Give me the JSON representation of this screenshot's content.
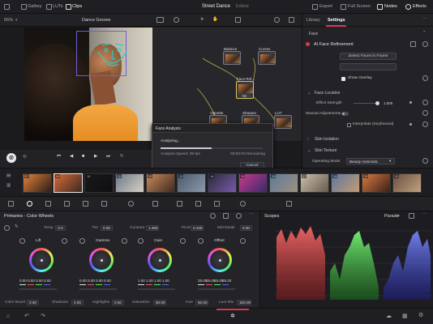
{
  "topbar": {
    "gallery": "Gallery",
    "luts": "LUTs",
    "clips": "Clips",
    "project": "Street Dance",
    "status": "Edited",
    "export": "Export",
    "fullscreen": "Full Screen",
    "nodes": "Nodes",
    "effects": "Effects"
  },
  "viewer_bar": {
    "zoom": "65%",
    "clip_name": "Dance Groove"
  },
  "panel": {
    "tab_library": "Library",
    "tab_settings": "Settings",
    "section": "Face",
    "fx_title": "AI Face Refinement",
    "detect_button": "Detect Faces in Frame",
    "show_overlay": "Show Overlay",
    "face_location": "Face Location",
    "effect_strength_label": "Effect Strength",
    "effect_strength_value": "1.000",
    "manual_adjustments": "Manual Adjustments",
    "interpolate": "Interpolate (Keyframed)",
    "skin_isolation": "Skin Isolation",
    "skin_texture": "Skin Texture",
    "operating_mode_label": "Operating Mode",
    "operating_mode_value": "Beauty Automatic"
  },
  "nodes": {
    "n1": "Balance",
    "n2": "Curves",
    "n3": "Face Ref...",
    "n4": "Vignette",
    "n5": "Sharpen",
    "n6": "LUT",
    "n3_num": "03"
  },
  "dialog": {
    "title": "Face Analysis",
    "status": "Analyzing...",
    "speed": "Analysis Speed: 39 fps",
    "remaining": "00:00:03 Remaining",
    "cancel": "Cancel",
    "progress": 0.5
  },
  "timeline": {
    "clip_labels": [
      "07",
      "08",
      "10",
      "11",
      "12",
      "13",
      "14",
      "15",
      "16",
      "17",
      "18",
      "19",
      "20"
    ]
  },
  "primaries": {
    "title": "Primaries - Color Wheels",
    "temp_label": "Temp",
    "temp": "0.0",
    "tint_label": "Tint",
    "tint": "0.00",
    "contrast_label": "Contrast",
    "contrast": "1.000",
    "pivot_label": "Pivot",
    "pivot": "0.435",
    "middetail_label": "Mid Detail",
    "middetail": "0.00",
    "wheels": [
      {
        "name": "Lift",
        "vals": [
          "0.00",
          "0.00",
          "0.00",
          "0.00"
        ]
      },
      {
        "name": "Gamma",
        "vals": [
          "0.00",
          "0.00",
          "0.00",
          "0.00"
        ]
      },
      {
        "name": "Gain",
        "vals": [
          "1.00",
          "1.00",
          "1.00",
          "1.00"
        ]
      },
      {
        "name": "Offset",
        "vals": [
          "25.00",
          "25.00",
          "25.00",
          "25.00"
        ]
      }
    ],
    "colorboost_label": "Color Boost",
    "colorboost": "0.00",
    "shadows_label": "Shadows",
    "shadows": "0.00",
    "highlights_label": "Highlights",
    "highlights": "0.00",
    "saturation_label": "Saturation",
    "saturation": "50.00",
    "hue_label": "Hue",
    "hue": "50.00",
    "lummix_label": "Lum Mix",
    "lummix": "100.00"
  },
  "scopes": {
    "title": "Scopes",
    "mode": "Parade"
  }
}
